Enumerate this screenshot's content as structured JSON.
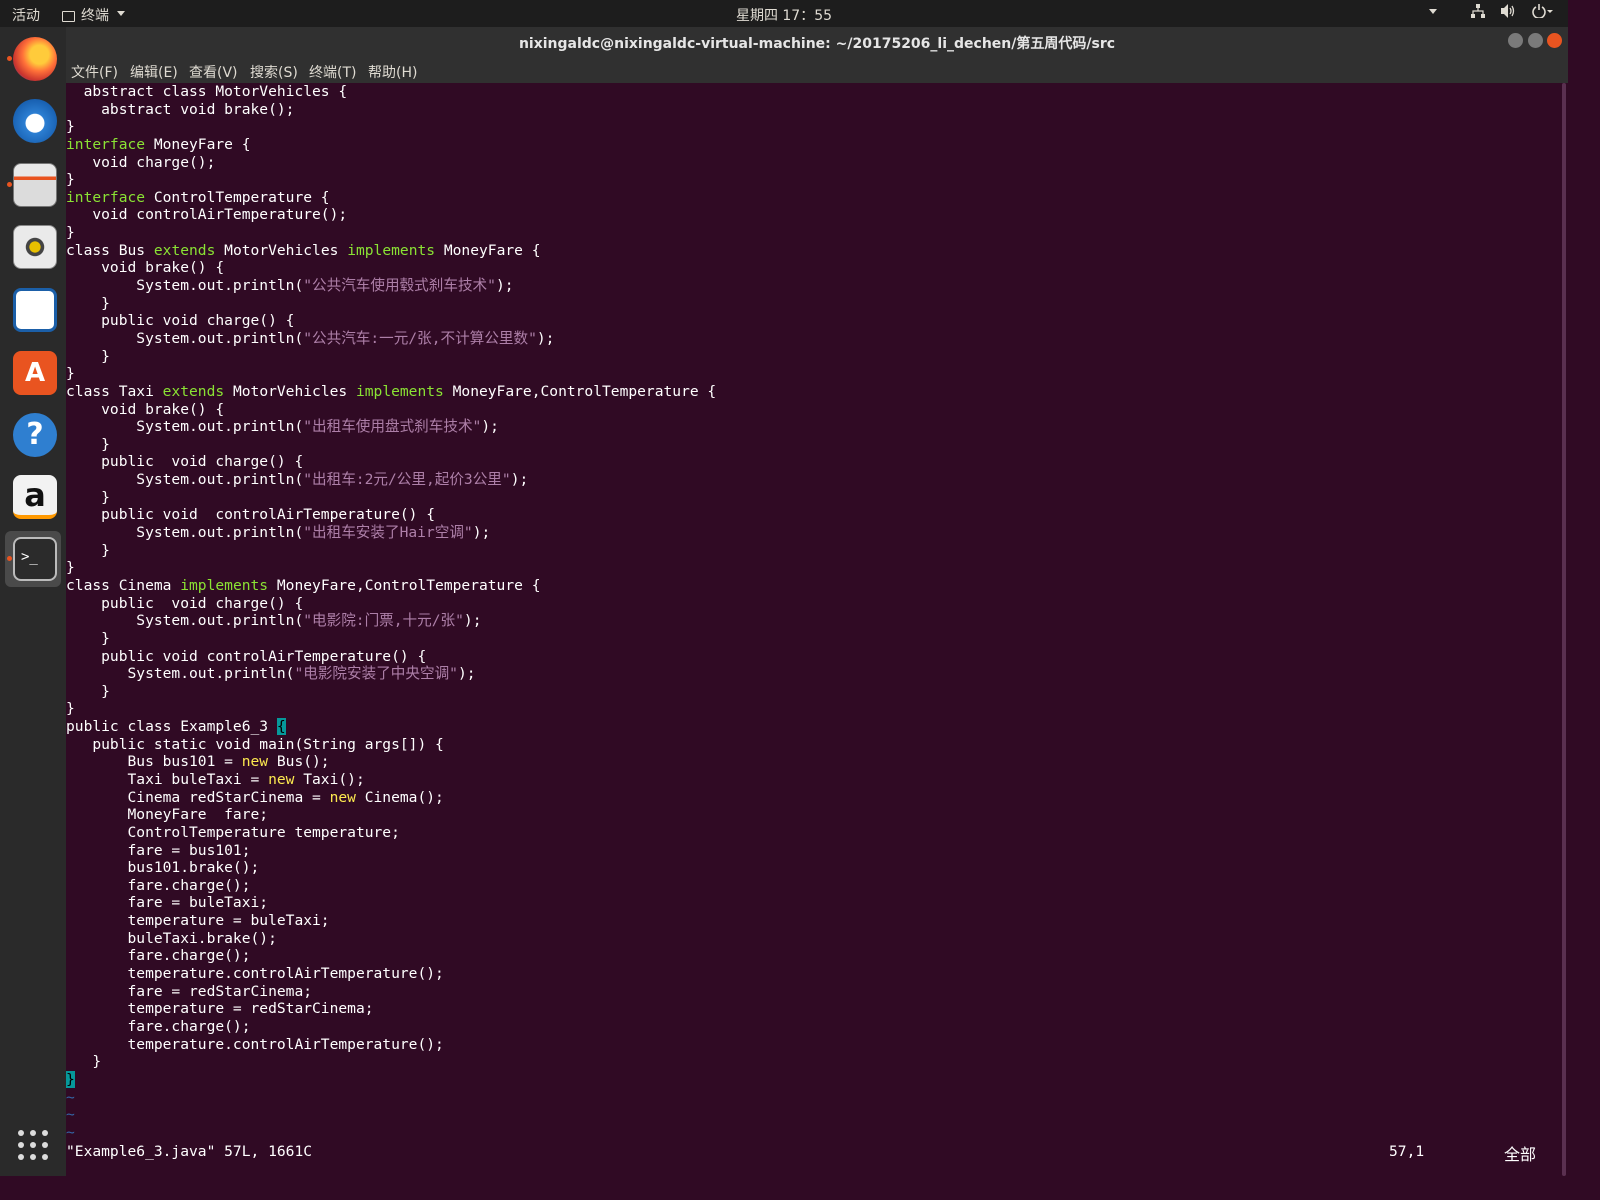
{
  "top_panel": {
    "activities": "活动",
    "app_name": "终端",
    "clock": "星期四 17：55",
    "tray_icons": [
      "chevron-down-icon",
      "network-icon",
      "volume-icon",
      "power-icon"
    ]
  },
  "dock": {
    "items": [
      "firefox-icon",
      "thunderbird-icon",
      "files-icon",
      "rhythmbox-icon",
      "writer-icon",
      "software-center-icon",
      "help-icon",
      "amazon-icon",
      "terminal-icon"
    ],
    "apps_grid": "show-applications-icon"
  },
  "window": {
    "title": "nixingaldc@nixingaldc-virtual-machine: ~/20175206_li_dechen/第五周代码/src",
    "menu": [
      "文件(F)",
      "编辑(E)",
      "查看(V)",
      "搜索(S)",
      "终端(T)",
      "帮助(H)"
    ]
  },
  "colors": {
    "terminal_bg": "#300a24",
    "keyword": "#8ae234",
    "new_keyword": "#fce94f",
    "string": "#ad7fa8",
    "cursor": "#06989a",
    "tilde": "#3465a4"
  },
  "editor": {
    "lines": [
      [
        [
          "",
          "  abstract class MotorVehicles {"
        ]
      ],
      [
        [
          "",
          "    abstract void brake();"
        ]
      ],
      [
        [
          "",
          "}"
        ]
      ],
      [
        [
          "kw",
          "interface"
        ],
        [
          "",
          " MoneyFare {"
        ]
      ],
      [
        [
          "",
          "   void charge();"
        ]
      ],
      [
        [
          "",
          "}"
        ]
      ],
      [
        [
          "kw",
          "interface"
        ],
        [
          "",
          " ControlTemperature {"
        ]
      ],
      [
        [
          "",
          "   void controlAirTemperature();"
        ]
      ],
      [
        [
          "",
          "}"
        ]
      ],
      [
        [
          "",
          "class Bus "
        ],
        [
          "kw",
          "extends"
        ],
        [
          "",
          " MotorVehicles "
        ],
        [
          "kw",
          "implements"
        ],
        [
          "",
          " MoneyFare {"
        ]
      ],
      [
        [
          "",
          "    void brake() {"
        ]
      ],
      [
        [
          "",
          "        System.out.println("
        ],
        [
          "st",
          "\"公共汽车使用毂式刹车技术\""
        ],
        [
          "",
          ");"
        ]
      ],
      [
        [
          "",
          "    }"
        ]
      ],
      [
        [
          "",
          "    public void charge() {"
        ]
      ],
      [
        [
          "",
          "        System.out.println("
        ],
        [
          "st",
          "\"公共汽车:一元/张,不计算公里数\""
        ],
        [
          "",
          ");"
        ]
      ],
      [
        [
          "",
          "    }"
        ]
      ],
      [
        [
          "",
          "}"
        ]
      ],
      [
        [
          "",
          "class Taxi "
        ],
        [
          "kw",
          "extends"
        ],
        [
          "",
          " MotorVehicles "
        ],
        [
          "kw",
          "implements"
        ],
        [
          "",
          " MoneyFare,ControlTemperature {"
        ]
      ],
      [
        [
          "",
          "    void brake() {"
        ]
      ],
      [
        [
          "",
          "        System.out.println("
        ],
        [
          "st",
          "\"出租车使用盘式刹车技术\""
        ],
        [
          "",
          ");"
        ]
      ],
      [
        [
          "",
          "    }"
        ]
      ],
      [
        [
          "",
          "    public  void charge() {"
        ]
      ],
      [
        [
          "",
          "        System.out.println("
        ],
        [
          "st",
          "\"出租车:2元/公里,起价3公里\""
        ],
        [
          "",
          ");"
        ]
      ],
      [
        [
          "",
          "    }"
        ]
      ],
      [
        [
          "",
          "    public void  controlAirTemperature() {"
        ]
      ],
      [
        [
          "",
          "        System.out.println("
        ],
        [
          "st",
          "\"出租车安装了Hair空调\""
        ],
        [
          "",
          ");"
        ]
      ],
      [
        [
          "",
          "    }"
        ]
      ],
      [
        [
          "",
          "}"
        ]
      ],
      [
        [
          "",
          "class Cinema "
        ],
        [
          "kw",
          "implements"
        ],
        [
          "",
          " MoneyFare,ControlTemperature {"
        ]
      ],
      [
        [
          "",
          "    public  void charge() {"
        ]
      ],
      [
        [
          "",
          "        System.out.println("
        ],
        [
          "st",
          "\"电影院:门票,十元/张\""
        ],
        [
          "",
          ");"
        ]
      ],
      [
        [
          "",
          "    }"
        ]
      ],
      [
        [
          "",
          "    public void controlAirTemperature() {"
        ]
      ],
      [
        [
          "",
          "       System.out.println("
        ],
        [
          "st",
          "\"电影院安装了中央空调\""
        ],
        [
          "",
          ");"
        ]
      ],
      [
        [
          "",
          "    }"
        ]
      ],
      [
        [
          "",
          "}"
        ]
      ],
      [
        [
          "",
          "public class Example6_3 "
        ],
        [
          "cur",
          "{"
        ]
      ],
      [
        [
          "",
          "   public static void main(String args[]) {"
        ]
      ],
      [
        [
          "",
          "       Bus bus101 = "
        ],
        [
          "ky",
          "new"
        ],
        [
          "",
          " Bus();"
        ]
      ],
      [
        [
          "",
          "       Taxi buleTaxi = "
        ],
        [
          "ky",
          "new"
        ],
        [
          "",
          " Taxi();"
        ]
      ],
      [
        [
          "",
          "       Cinema redStarCinema = "
        ],
        [
          "ky",
          "new"
        ],
        [
          "",
          " Cinema();"
        ]
      ],
      [
        [
          "",
          "       MoneyFare  fare;"
        ]
      ],
      [
        [
          "",
          "       ControlTemperature temperature;"
        ]
      ],
      [
        [
          "",
          "       fare = bus101;"
        ]
      ],
      [
        [
          "",
          "       bus101.brake();"
        ]
      ],
      [
        [
          "",
          "       fare.charge();"
        ]
      ],
      [
        [
          "",
          "       fare = buleTaxi;"
        ]
      ],
      [
        [
          "",
          "       temperature = buleTaxi;"
        ]
      ],
      [
        [
          "",
          "       buleTaxi.brake();"
        ]
      ],
      [
        [
          "",
          "       fare.charge();"
        ]
      ],
      [
        [
          "",
          "       temperature.controlAirTemperature();"
        ]
      ],
      [
        [
          "",
          "       fare = redStarCinema;"
        ]
      ],
      [
        [
          "",
          "       temperature = redStarCinema;"
        ]
      ],
      [
        [
          "",
          "       fare.charge();"
        ]
      ],
      [
        [
          "",
          "       temperature.controlAirTemperature();"
        ]
      ],
      [
        [
          "",
          "   }"
        ]
      ],
      [
        [
          "cur",
          "}"
        ]
      ],
      [
        [
          "tilde",
          "~"
        ]
      ],
      [
        [
          "tilde",
          "~"
        ]
      ],
      [
        [
          "tilde",
          "~"
        ]
      ]
    ],
    "status_file": "\"Example6_3.java\" 57L, 1661C",
    "status_position": "57,1",
    "status_scroll": "全部"
  }
}
